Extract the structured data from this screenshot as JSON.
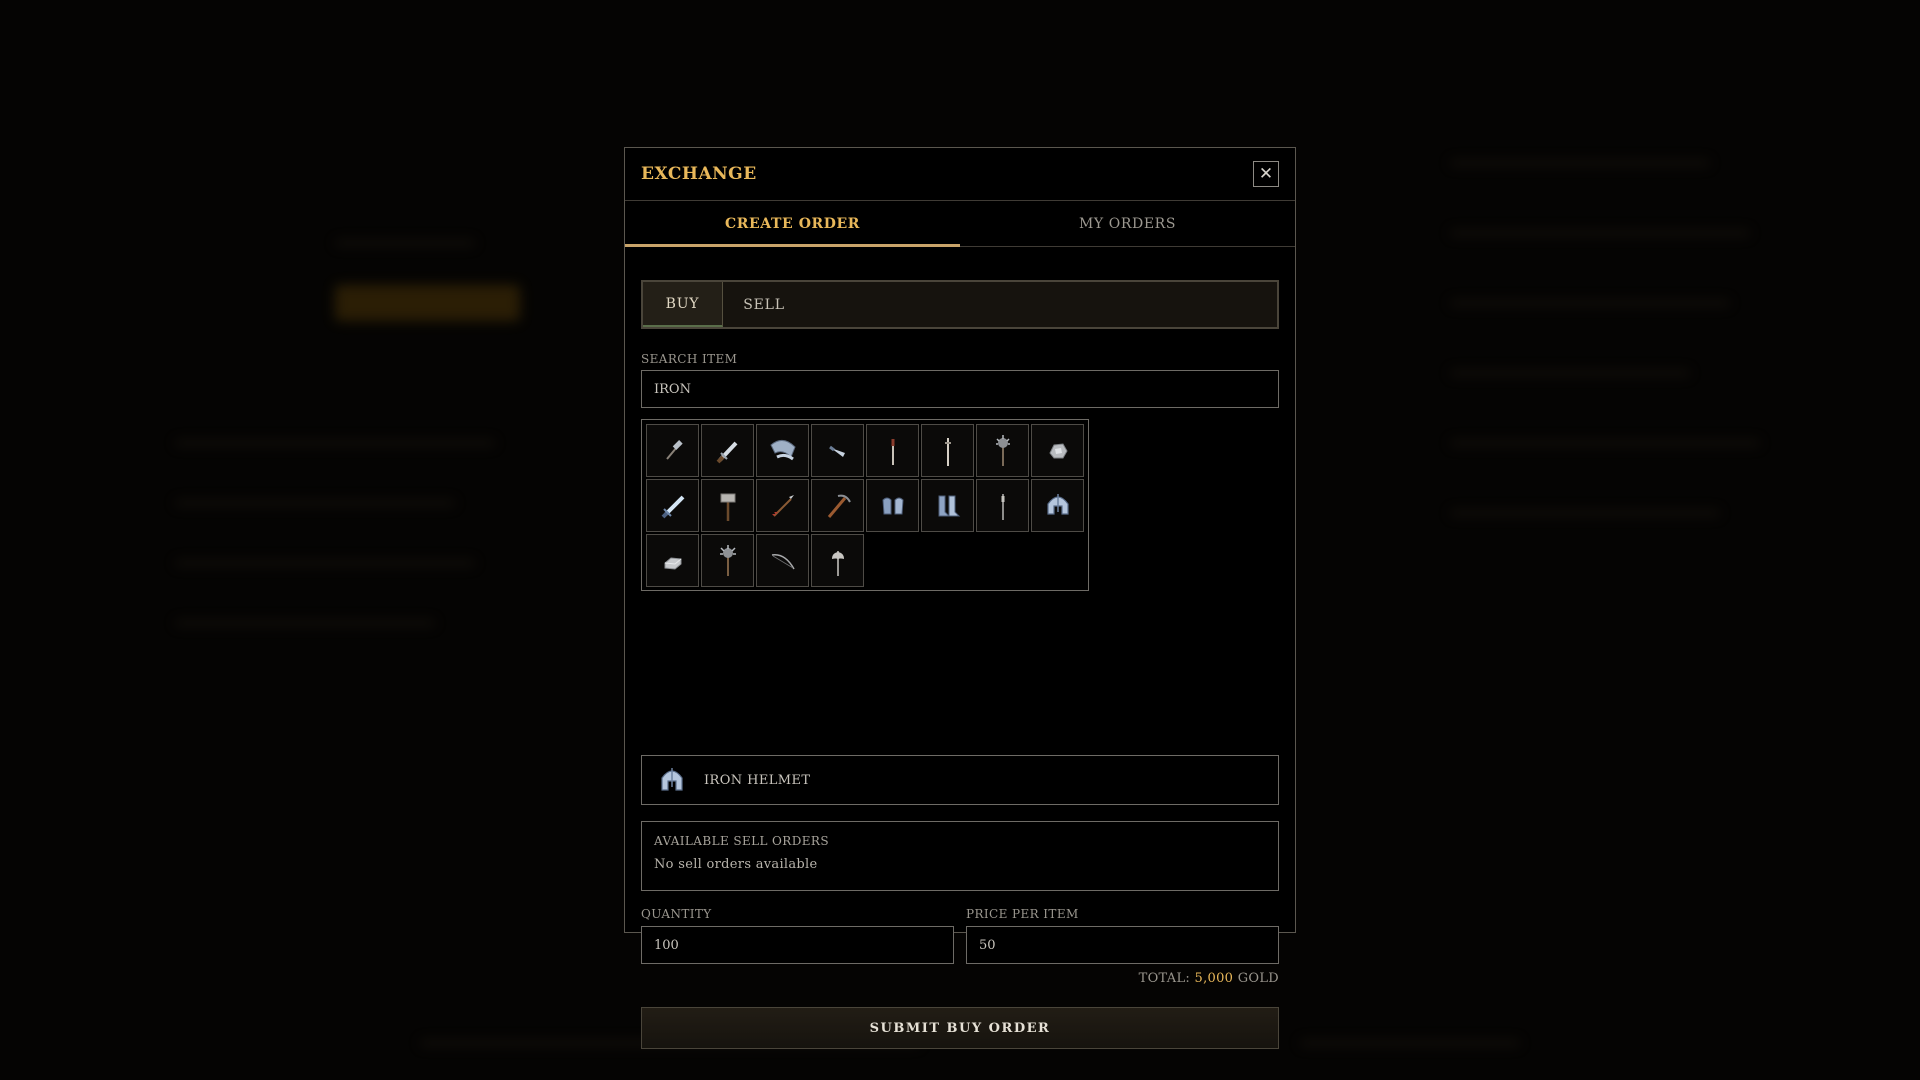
{
  "modal": {
    "title": "EXCHANGE",
    "close_icon": "close-icon",
    "tabs": [
      {
        "label": "CREATE ORDER",
        "active": true
      },
      {
        "label": "MY ORDERS",
        "active": false
      }
    ],
    "mode": {
      "buy_label": "BUY",
      "sell_label": "SELL",
      "selected": "BUY"
    },
    "search": {
      "label": "SEARCH ITEM",
      "value": "IRON"
    },
    "items": [
      {
        "name": "iron-hammer-icon"
      },
      {
        "name": "iron-dagger-icon"
      },
      {
        "name": "iron-shoulder-armor-icon"
      },
      {
        "name": "iron-blade-icon"
      },
      {
        "name": "iron-spear-icon"
      },
      {
        "name": "iron-spear-alt-icon"
      },
      {
        "name": "iron-mace-icon"
      },
      {
        "name": "iron-ore-icon"
      },
      {
        "name": "iron-sword-icon"
      },
      {
        "name": "iron-warhammer-icon"
      },
      {
        "name": "iron-arrow-icon"
      },
      {
        "name": "iron-pickaxe-icon"
      },
      {
        "name": "iron-gauntlets-icon"
      },
      {
        "name": "iron-boots-icon"
      },
      {
        "name": "iron-staff-icon"
      },
      {
        "name": "iron-helmet-icon"
      },
      {
        "name": "iron-ingot-icon"
      },
      {
        "name": "iron-morningstar-icon"
      },
      {
        "name": "iron-bow-icon"
      },
      {
        "name": "iron-axe-icon"
      }
    ],
    "selected_item": {
      "icon": "iron-helmet-icon",
      "name": "IRON HELMET"
    },
    "orders": {
      "title": "AVAILABLE SELL ORDERS",
      "empty_text": "No sell orders available"
    },
    "quantity": {
      "label": "QUANTITY",
      "value": "100"
    },
    "price": {
      "label": "PRICE PER ITEM",
      "value": "50"
    },
    "total": {
      "label": "TOTAL:",
      "amount": "5,000",
      "currency": "GOLD"
    },
    "submit_label": "SUBMIT BUY ORDER",
    "colors": {
      "accent": "#e9b85a",
      "background": "#000000",
      "border": "#6e6b66"
    }
  }
}
